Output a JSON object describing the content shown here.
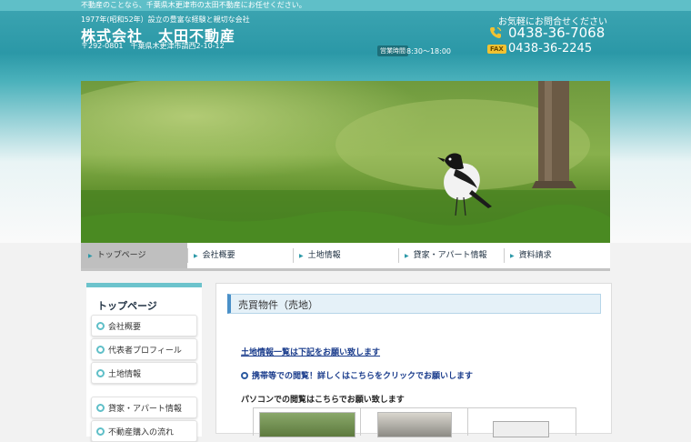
{
  "top_bar": {
    "text": "不動産のことなら、千葉県木更津市の太田不動産にお任せください。"
  },
  "header": {
    "catchphrase": "1977年(昭和52年）設立の豊富な経験と親切な会社",
    "company_name": "株式会社　太田不動産",
    "address": "〒292-0801　千葉県木更津市請西2-10-12",
    "hours_label": "営業時間",
    "hours": "8:30〜18:00",
    "contact_label": "お気軽にお問合せください",
    "tel_icon": "phone-icon",
    "tel": "0438-36-7068",
    "fax_label": "FAX",
    "fax": "0438-36-2245"
  },
  "nav": {
    "items": [
      {
        "label": "トップページ"
      },
      {
        "label": "会社概要"
      },
      {
        "label": "土地情報"
      },
      {
        "label": "貸家・アパート情報"
      },
      {
        "label": "資料請求"
      }
    ],
    "active_index": 0
  },
  "sidebar": {
    "title": "トップページ",
    "items": [
      {
        "label": "会社概要"
      },
      {
        "label": "代表者プロフィール"
      },
      {
        "label": "土地情報"
      },
      {
        "label": "貸家・アパート情報"
      },
      {
        "label": "不動産購入の流れ"
      }
    ]
  },
  "main": {
    "title": "売買物件（売地）",
    "land_list_link": "土地情報一覧は下記をお願い致します",
    "mobile_link": "携帯等での閲覧！詳しくはこちらをクリックでお願いします",
    "pc_text": "パソコンでの閲覧はこちらでお願い致します"
  },
  "colors": {
    "accent": "#2b98a7",
    "link": "#1a3c8c",
    "fax_badge": "#f1c232"
  }
}
